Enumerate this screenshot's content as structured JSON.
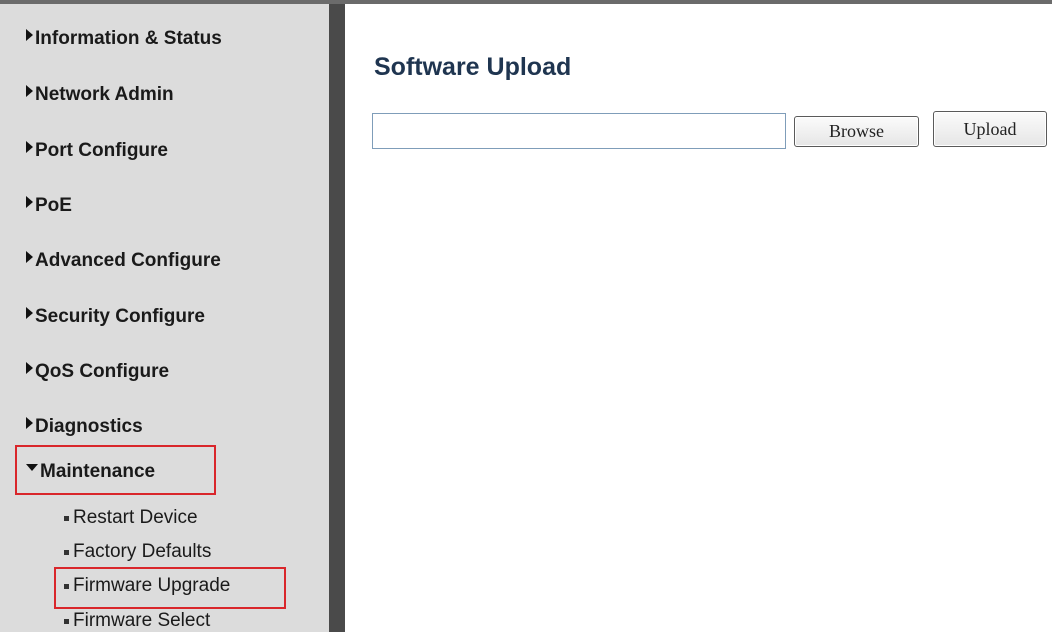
{
  "sidebar": {
    "items": [
      {
        "label": "Information & Status"
      },
      {
        "label": "Network Admin"
      },
      {
        "label": "Port Configure"
      },
      {
        "label": "PoE"
      },
      {
        "label": "Advanced Configure"
      },
      {
        "label": "Security Configure"
      },
      {
        "label": "QoS Configure"
      },
      {
        "label": "Diagnostics"
      },
      {
        "label": "Maintenance",
        "expanded": true
      }
    ],
    "sub_items": [
      {
        "label": "Restart Device"
      },
      {
        "label": "Factory Defaults"
      },
      {
        "label": "Firmware Upgrade",
        "selected": true
      },
      {
        "label": "Firmware Select"
      }
    ]
  },
  "main": {
    "title": "Software Upload",
    "file_path": "",
    "browse_label": "Browse",
    "upload_label": "Upload"
  },
  "colors": {
    "sidebar_bg": "#dcdcdc",
    "divider": "#4a4a4a",
    "title": "#1f3550",
    "highlight": "#d9262b"
  }
}
